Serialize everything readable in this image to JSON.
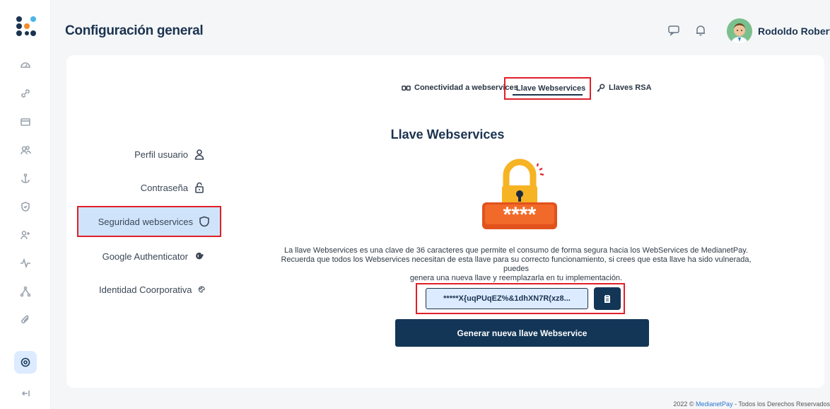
{
  "header": {
    "title": "Configuración general",
    "user_name": "Rodoldo Roberto"
  },
  "menu": {
    "items": [
      {
        "label": "Perfil usuario",
        "icon": "user-icon"
      },
      {
        "label": "Contraseña",
        "icon": "lock-icon"
      },
      {
        "label": "Seguridad webservices",
        "icon": "shield-icon",
        "active": true
      },
      {
        "label": "Google Authenticator",
        "icon": "google-icon"
      },
      {
        "label": "Identidad Coorporativa",
        "icon": "palette-icon"
      }
    ]
  },
  "tabs": [
    {
      "label": "Conectividad a webservices",
      "icon": "connect-icon"
    },
    {
      "label": "Llave Webservices",
      "icon": "key-icon",
      "active": true
    },
    {
      "label": "Llaves RSA",
      "icon": "key-icon"
    }
  ],
  "content": {
    "title": "Llave Webservices",
    "description_line1": "La llave Webservices es una clave de 36 caracteres que permite el consumo de forma segura hacia los WebServices de MedianetPay.",
    "description_line2": "Recuerda que todos los Webservices necesitan de esta llave para su correcto funcionamiento, si crees que esta llave ha sido vulnerada, puedes",
    "description_line3": "genera una nueva llave y reemplazarla en tu implementación.",
    "key_value": "*****X{uqPUqEZ%&1dhXN7R(xz8...",
    "generate_button": "Generar nueva llave Webservice",
    "illustration_text": "****"
  },
  "footer": {
    "year": "2022 ©",
    "brand": "MedianetPay",
    "rest": "- Todos los Derechos Reservados"
  },
  "colors": {
    "primary": "#133657",
    "highlight": "#e0202a",
    "active_bg": "#cfe4fb"
  }
}
